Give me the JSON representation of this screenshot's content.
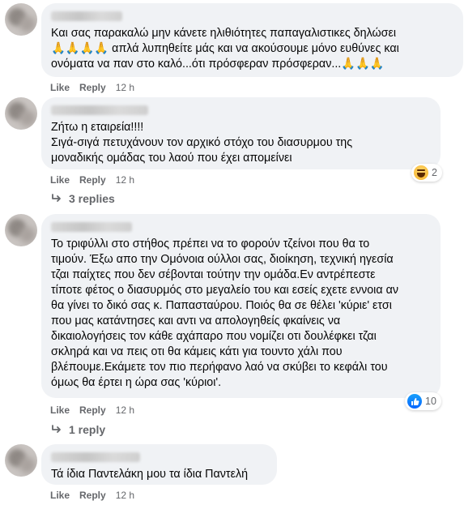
{
  "comments": [
    {
      "text": "Και σας παρακαλώ μην κάνετε ηλιθιότητες παπαγαλιστικες δηλώσει\n🙏🙏🙏🙏 απλά λυπηθείτε μάς και να ακούσουμε μόνο ευθύνες και\nονόματα να παν στο καλό...ότι πρόσφεραν πρόσφεραν...🙏🙏🙏",
      "like": "Like",
      "reply": "Reply",
      "time": "12 h"
    },
    {
      "text": "Ζήτω η εταιρεία!!!!\nΣιγά-σιγά πετυχάνουν τον αρχικό στόχο του διασυρμου της\nμοναδικής ομάδας του λαού που έχει απομείνει",
      "like": "Like",
      "reply": "Reply",
      "time": "12 h",
      "reaction_icon": "haha-emoji-icon",
      "reaction_count": "2",
      "replies_label": "3 replies"
    },
    {
      "text": "Το τριφύλλι στο στήθος πρέπει να το φορούν τζείνοι που θα το\nτιμούν. Έξω απο την Ομόνοια ούλλοι σας, διοίκηση, τεχνική ηγεσία\nτζαι παίχτες που δεν σέβονται τούτην την ομάδα.Εν αντρέπεστε\nτίποτε φέτος ο διασυρμός στο μεγαλείο του και εσείς εχετε εννοια αν\nθα γίνει το δικό σας κ. Παπασταύρου. Ποιός θα σε θέλει 'κύριε' ετσι\nπου μας κατάντησες και αντι να απολογηθείς φκαίνεις να\nδικαιολογήσεις τον κάθε αχάπαρο που νομίζει οτι δουλέφκει τζαι\nσκληρά και να πεις οτι θα κάμεις κάτι για τουντο χάλι που\nβλέπουμε.Εκάμετε τον πιο περήφανο λαό να σκύβει το κεφάλι του\nόμως θα έρτει η ώρα σας 'κύριοι'.",
      "like": "Like",
      "reply": "Reply",
      "time": "12 h",
      "reaction_icon": "like-thumb-icon",
      "reaction_count": "10",
      "replies_label": "1 reply"
    },
    {
      "text": "Τά ίδια Παντελάκη μου τα ίδια Παντελή",
      "like": "Like",
      "reply": "Reply",
      "time": "12 h"
    }
  ],
  "colors": {
    "bubble": "#f0f2f5",
    "meta": "#65676b",
    "text": "#050505",
    "like_blue": "#0866ff",
    "haha_yellow": "#f7b125"
  }
}
